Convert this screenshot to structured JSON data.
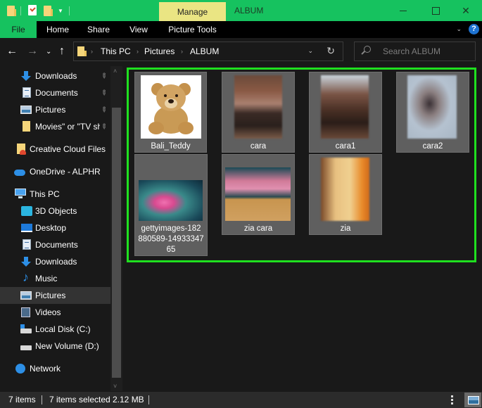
{
  "window": {
    "title": "ALBUM",
    "contextual_tab_group": "Manage",
    "accent_color": "#16c25f",
    "selection_border_color": "#1fe01f"
  },
  "quick_access_toolbar": {
    "icons": [
      "folder-icon",
      "properties-icon",
      "new-folder-icon",
      "customize-dropdown-icon"
    ]
  },
  "window_controls": {
    "minimize": "minimize",
    "maximize": "maximize",
    "close": "✕"
  },
  "ribbon": {
    "tabs": [
      {
        "label": "File",
        "active": true
      },
      {
        "label": "Home"
      },
      {
        "label": "Share"
      },
      {
        "label": "View"
      },
      {
        "label": "Picture Tools"
      }
    ],
    "expand_icon": "⌄",
    "help_icon": "?"
  },
  "navigation": {
    "back": "←",
    "forward": "→",
    "recent": "⌄",
    "up": "↑",
    "breadcrumb": [
      "This PC",
      "Pictures",
      "ALBUM"
    ],
    "breadcrumb_sep": "›",
    "address_dropdown": "⌄",
    "refresh": "↻",
    "search_placeholder": "Search ALBUM"
  },
  "sidebar": {
    "quick_access": [
      {
        "label": "Downloads",
        "icon": "downloads-icon",
        "pinned": true
      },
      {
        "label": "Documents",
        "icon": "documents-icon",
        "pinned": true
      },
      {
        "label": "Pictures",
        "icon": "pictures-icon",
        "pinned": true
      },
      {
        "label": "Movies\" or \"TV sh",
        "icon": "folder-icon",
        "pinned": true
      }
    ],
    "creative_cloud": {
      "label": "Creative Cloud Files"
    },
    "onedrive": {
      "label": "OneDrive - ALPHR"
    },
    "this_pc": {
      "label": "This PC",
      "children": [
        {
          "label": "3D Objects"
        },
        {
          "label": "Desktop"
        },
        {
          "label": "Documents"
        },
        {
          "label": "Downloads"
        },
        {
          "label": "Music"
        },
        {
          "label": "Pictures",
          "selected": true
        },
        {
          "label": "Videos"
        },
        {
          "label": "Local Disk (C:)"
        },
        {
          "label": "New Volume (D:)"
        }
      ]
    },
    "network": {
      "label": "Network"
    },
    "pin_glyph": "📌",
    "scroll_up": "˄",
    "scroll_down": "˅"
  },
  "files": [
    {
      "name": "Bali_Teddy",
      "kind": "teddy bear photo"
    },
    {
      "name": "cara",
      "kind": "blurred portrait"
    },
    {
      "name": "cara1",
      "kind": "blurred portrait"
    },
    {
      "name": "cara2",
      "kind": "blurred portrait"
    },
    {
      "name": "gettyimages-182880589-1493334765",
      "name_lines": [
        "gettyimages-182",
        "880589-14933347",
        "65"
      ],
      "kind": "pink lotus photo"
    },
    {
      "name": "zia cara",
      "kind": "collage with teddy bears"
    },
    {
      "name": "zia",
      "kind": "blurred portrait"
    }
  ],
  "status_bar": {
    "item_count": "7 items",
    "selected": "7 items selected",
    "size": "2.12 MB",
    "view_modes": [
      "details-view",
      "large-icons-view"
    ],
    "active_view": "large-icons-view"
  }
}
